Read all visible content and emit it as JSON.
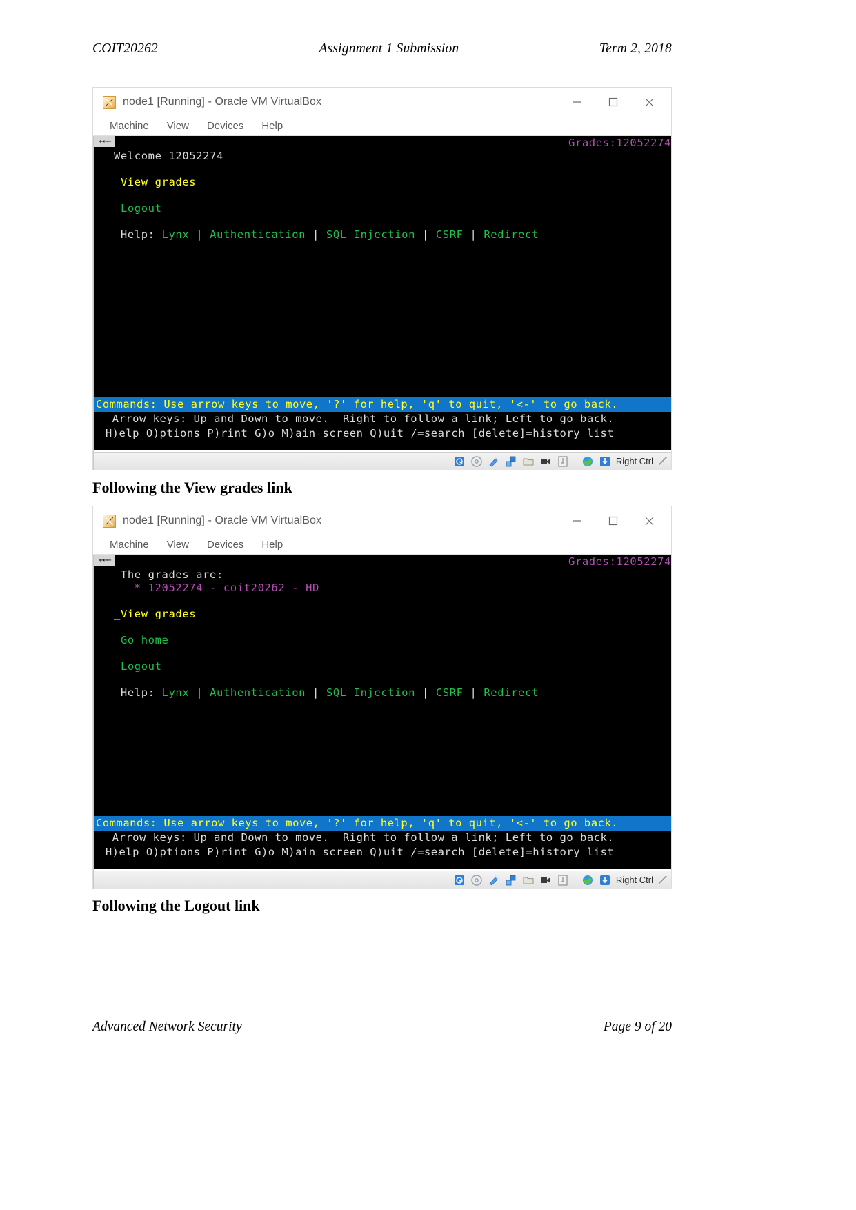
{
  "header": {
    "left": "COIT20262",
    "center": "Assignment 1 Submission",
    "right": "Term 2, 2018"
  },
  "footer": {
    "left": "Advanced Network Security",
    "right": "Page 9 of 20"
  },
  "captions": {
    "first": "Following the View grades link",
    "second": "Following the Logout link"
  },
  "window": {
    "title": "node1 [Running] - Oracle VM VirtualBox",
    "icon_name": "virtualbox-icon",
    "minimize_label": "–",
    "maximize_label": "□",
    "close_label": "✕",
    "menu": [
      "Machine",
      "View",
      "Devices",
      "Help"
    ],
    "statusbar": {
      "host_key": "Right Ctrl",
      "icons": [
        "hard-disk-icon",
        "optical-disk-icon",
        "usb-icon",
        "network-icon",
        "shared-folder-icon",
        "video-capture-icon",
        "display-icon",
        "globe-icon",
        "mouse-integration-icon"
      ]
    }
  },
  "terminal1": {
    "grabber": "←←←",
    "topright": "Grades:12052274",
    "lines": [
      {
        "segments": [
          {
            "text": "Welcome 12052274",
            "color": "white"
          }
        ]
      },
      {
        "segments": [
          {
            "text": "",
            "color": "white"
          }
        ]
      },
      {
        "segments": [
          {
            "text": "_",
            "color": "white"
          },
          {
            "text": "View grades",
            "color": "yellow"
          }
        ]
      },
      {
        "segments": [
          {
            "text": "",
            "color": "white"
          }
        ]
      },
      {
        "segments": [
          {
            "text": " ",
            "color": "white"
          },
          {
            "text": "Logout",
            "color": "green"
          }
        ]
      },
      {
        "segments": [
          {
            "text": "",
            "color": "white"
          }
        ]
      },
      {
        "segments": [
          {
            "text": " Help: ",
            "color": "white"
          },
          {
            "text": "Lynx",
            "color": "green"
          },
          {
            "text": " | ",
            "color": "white"
          },
          {
            "text": "Authentication",
            "color": "green"
          },
          {
            "text": " | ",
            "color": "white"
          },
          {
            "text": "SQL Injection",
            "color": "green"
          },
          {
            "text": " | ",
            "color": "white"
          },
          {
            "text": "CSRF",
            "color": "green"
          },
          {
            "text": " | ",
            "color": "white"
          },
          {
            "text": "Redirect",
            "color": "green"
          }
        ]
      }
    ],
    "status_blue": "Commands: Use arrow keys to move, '?' for help, 'q' to quit, '<-' to go back.",
    "help_line_1": "  Arrow keys: Up and Down to move.  Right to follow a link; Left to go back.",
    "help_line_2": " H)elp O)ptions P)rint G)o M)ain screen Q)uit /=search [delete]=history list"
  },
  "terminal2": {
    "grabber": "←←←",
    "topright": "Grades:12052274",
    "lines": [
      {
        "segments": [
          {
            "text": " The grades are:",
            "color": "white"
          }
        ]
      },
      {
        "segments": [
          {
            "text": "   * 12052274 - coit20262 - HD",
            "color": "magenta"
          }
        ]
      },
      {
        "segments": [
          {
            "text": "",
            "color": "white"
          }
        ]
      },
      {
        "segments": [
          {
            "text": "_",
            "color": "white"
          },
          {
            "text": "View grades",
            "color": "yellow"
          }
        ]
      },
      {
        "segments": [
          {
            "text": "",
            "color": "white"
          }
        ]
      },
      {
        "segments": [
          {
            "text": " ",
            "color": "white"
          },
          {
            "text": "Go home",
            "color": "green"
          }
        ]
      },
      {
        "segments": [
          {
            "text": "",
            "color": "white"
          }
        ]
      },
      {
        "segments": [
          {
            "text": " ",
            "color": "white"
          },
          {
            "text": "Logout",
            "color": "green"
          }
        ]
      },
      {
        "segments": [
          {
            "text": "",
            "color": "white"
          }
        ]
      },
      {
        "segments": [
          {
            "text": " Help: ",
            "color": "white"
          },
          {
            "text": "Lynx",
            "color": "green"
          },
          {
            "text": " | ",
            "color": "white"
          },
          {
            "text": "Authentication",
            "color": "green"
          },
          {
            "text": " | ",
            "color": "white"
          },
          {
            "text": "SQL Injection",
            "color": "green"
          },
          {
            "text": " | ",
            "color": "white"
          },
          {
            "text": "CSRF",
            "color": "green"
          },
          {
            "text": " | ",
            "color": "white"
          },
          {
            "text": "Redirect",
            "color": "green"
          }
        ]
      }
    ],
    "status_blue": "Commands: Use arrow keys to move, '?' for help, 'q' to quit, '<-' to go back.",
    "help_line_1": "  Arrow keys: Up and Down to move.  Right to follow a link; Left to go back.",
    "help_line_2": " H)elp O)ptions P)rint G)o M)ain screen Q)uit /=search [delete]=history list"
  },
  "colors": {
    "terminal_bg": "#000000",
    "link_green": "#1fbf4a",
    "active_link_yellow": "#ffff22",
    "grades_magenta": "#b14fb1",
    "status_blue_bg": "#1175c9"
  }
}
